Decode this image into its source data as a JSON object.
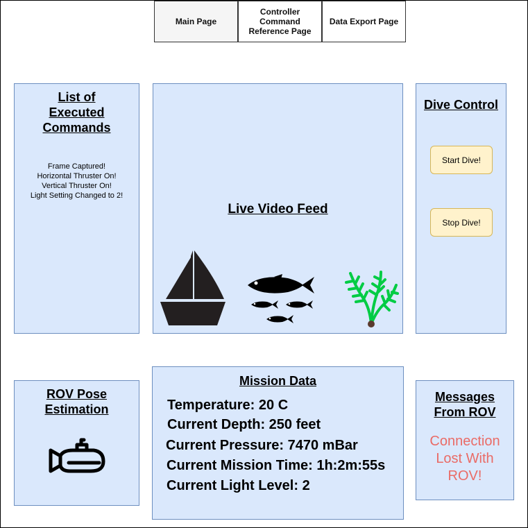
{
  "tabs": {
    "main": "Main Page",
    "controller": "Controller Command Reference Page",
    "export": "Data Export Page"
  },
  "commands_panel": {
    "title": "List of Executed Commands",
    "items": [
      "Frame Captured!",
      "Horizontal Thruster On!",
      "Vertical Thruster On!",
      "Light Setting Changed to 2!"
    ]
  },
  "video_panel": {
    "title": "Live Video Feed",
    "icons": [
      "sailboat-icon",
      "fish-icon",
      "seaweed-icon"
    ]
  },
  "dive_panel": {
    "title": "Dive Control",
    "start_label": "Start Dive!",
    "stop_label": "Stop Dive!"
  },
  "pose_panel": {
    "title": "ROV Pose Estimation",
    "icon": "submarine-icon"
  },
  "mission_panel": {
    "title": "Mission Data",
    "lines": [
      "Temperature: 20 C",
      "Current Depth: 250 feet",
      "Current Pressure: 7470 mBar",
      "Current Mission Time: 1h:2m:55s",
      "Current Light Level: 2"
    ]
  },
  "messages_panel": {
    "title": "Messages From ROV",
    "message": "Connection Lost With ROV!"
  },
  "colors": {
    "panel_fill": "#dae8fc",
    "panel_border": "#6c8ebf",
    "button_fill": "#fff2cc",
    "button_border": "#d6b656",
    "message_text": "#ea6b66",
    "seaweed": "#00cc44"
  }
}
